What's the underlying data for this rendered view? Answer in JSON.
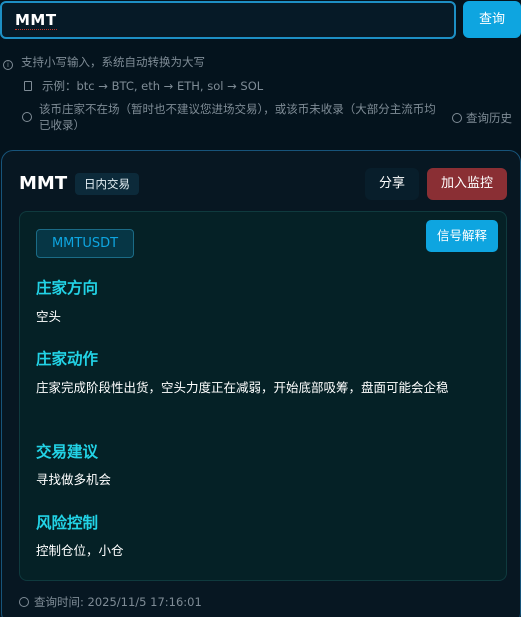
{
  "search": {
    "value": "MMT",
    "button_label": "查询"
  },
  "hints": {
    "lowercase": "支持小写输入，系统自动转换为大写",
    "example": "示例：btc → BTC, eth → ETH, sol → SOL",
    "warning": "该币庄家不在场（暂时也不建议您进场交易），或该币未收录（大部分主流币均已收录）",
    "history_label": "查询历史"
  },
  "card": {
    "coin": "MMT",
    "tag": "日内交易",
    "share_label": "分享",
    "monitor_label": "加入监控",
    "symbol": "MMTUSDT",
    "explain_label": "信号解释",
    "sections": [
      {
        "heading": "庄家方向",
        "text": "空头"
      },
      {
        "heading": "庄家动作",
        "text": "庄家完成阶段性出货，空头力度正在减弱，开始底部吸筹，盘面可能会企稳"
      },
      {
        "heading": "交易建议",
        "text": "寻找做多机会"
      },
      {
        "heading": "风险控制",
        "text": "控制仓位，小仓"
      }
    ],
    "query_time": "查询时间: 2025/11/5 17:16:01"
  },
  "colors": {
    "accent": "#0ea5e0",
    "heading": "#22d3e6",
    "monitor": "#8a2f34",
    "background": "#04131d"
  }
}
